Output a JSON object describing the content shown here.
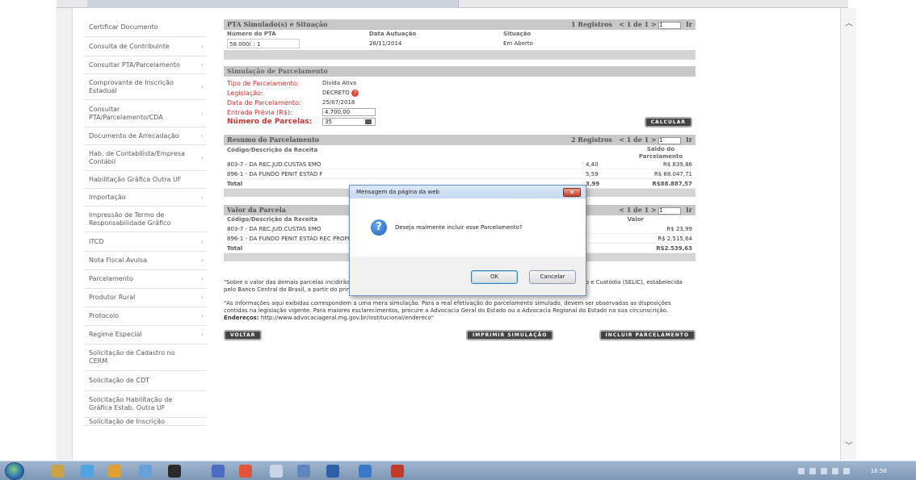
{
  "sidebar": {
    "items": [
      {
        "label": "Certificar Documento",
        "chev": ""
      },
      {
        "label": "Consulta de Contribuinte",
        "chev": "›"
      },
      {
        "label": "Consultar PTA/Parcelamento",
        "chev": "›"
      },
      {
        "label": "Comprovante de Inscrição Estadual",
        "chev": "›"
      },
      {
        "label": "Consultar PTA/Parcelamento/CDA",
        "chev": "›"
      },
      {
        "label": "Documento de Arrecadação",
        "chev": "›"
      },
      {
        "label": "Hab. de Contabilista/Empresa Contábil",
        "chev": "›"
      },
      {
        "label": "Habilitação Gráfica Outra UF",
        "chev": ""
      },
      {
        "label": "Importação",
        "chev": "›"
      },
      {
        "label": "Impressão de Termo de Responsabilidade Gráfico",
        "chev": ""
      },
      {
        "label": "ITCD",
        "chev": "›"
      },
      {
        "label": "Nota Fiscal Avulsa",
        "chev": "›"
      },
      {
        "label": "Parcelamento",
        "chev": "›"
      },
      {
        "label": "Produtor Rural",
        "chev": "›"
      },
      {
        "label": "Protocolo",
        "chev": "›"
      },
      {
        "label": "Regime Especial",
        "chev": "›"
      },
      {
        "label": "Solicitação de Cadastro no CERM",
        "chev": ""
      },
      {
        "label": "Solicitação de CDT",
        "chev": ""
      },
      {
        "label": "Solicitação Habilitação de Gráfica Estab. Outra UF",
        "chev": ""
      },
      {
        "label": "Solicitação de Inscrição",
        "chev": ""
      }
    ]
  },
  "pta": {
    "title": "PTA Simulado(s) e Situação",
    "registros": "1 Registros",
    "pager": "< 1 de 1 >",
    "page_input": "1",
    "go": "Ir",
    "headers": [
      "Número do PTA",
      "Data Autuação",
      "Situação"
    ],
    "row": [
      "58.000(  :  1",
      "28/11/2014",
      "Em Aberto"
    ]
  },
  "simulacao": {
    "title": "Simulação de Parcelamento",
    "tipo_label": "Tipo de Parcelamento:",
    "tipo_value": "Dívida Ativa",
    "legislacao_label": "Legislação:",
    "legislacao_value": "DECRETO",
    "data_label": "Data de Parcelamento:",
    "data_value": "25/07/2018",
    "entrada_label": "Entrada Prévia (R$):",
    "entrada_value": "4.700,00",
    "parcelas_label": "Número de Parcelas:",
    "parcelas_value": "35",
    "calcular": "CALCULAR"
  },
  "resumo": {
    "title": "Resumo do Parcelamento",
    "registros": "2 Registros",
    "pager": "< 1 de 1 >",
    "page_input": "1",
    "go": "Ir",
    "col1": "Código/Descrição da Receita",
    "col_saldo": "Saldo do Parcelamento",
    "rows": [
      {
        "desc": "803-7 - DA REC.JUD.CUSTAS EMO",
        "mid": "4,40",
        "saldo": "R$ 839,86"
      },
      {
        "desc": "896-1 - DA FUNDO PENIT ESTAD F",
        "mid": "5,59",
        "saldo": "R$ 88.047,71"
      }
    ],
    "total_label": "Total",
    "total_mid": "3,99",
    "total_saldo": "R$88.887,57"
  },
  "valor": {
    "title": "Valor da Parcela",
    "pager": "< 1 de 1 >",
    "page_input": "1",
    "go": "Ir",
    "col1": "Código/Descrição da Receita",
    "col_valor": "Valor",
    "rows": [
      {
        "desc": "803-7 - DA REC.JUD.CUSTAS EMO",
        "valor": "R$ 23,99"
      },
      {
        "desc": "896-1 - DA FUNDO PENIT ESTAD REC PROPRIA",
        "valor": "R$ 2.515,64"
      }
    ],
    "total_label": "Total",
    "total_valor": "R$2.539,63"
  },
  "notes": {
    "p1": "\"Sobre o valor das demais parcelas incidirão juros moratórios equivalentes à Taxa Referencial do Sistema Especial de Liquidação e Custódia (SELIC), estabelecida pelo Banco Central do Brasil, a partir do primeiro dia do mês subsequente da entrada prévia;\"",
    "p2a": "\"As informações aqui exibidas correspondem a uma mera simulação. Para a real efetivação do parcelamento simulado, devem ser observadas as disposições contidas na legislação vigente. Para maiores esclarecimentos, procure a Advocacia Geral do Estado ou a Advocacia Regional do Estado na sua circunscrição.",
    "p2b": "Endereços:",
    "p2c": "http://www.advocaciageral.mg.gov.br/institucional/endereco\""
  },
  "actions": {
    "voltar": "VOLTAR",
    "imprimir": "IMPRIMIR SIMULAÇÃO",
    "incluir": "INCLUIR PARCELAMENTO"
  },
  "dialog": {
    "title": "Mensagem da página da web",
    "close": "✕",
    "message": "Deseja realmente incluir esse Parcelamento?",
    "ok": "OK",
    "cancel": "Cancelar"
  },
  "taskbar": {
    "clock": "16:56"
  },
  "colors": {
    "label_red": "#d03030",
    "bar_gray": "#c8c8c8",
    "dialog_border": "#6d8fc2"
  }
}
